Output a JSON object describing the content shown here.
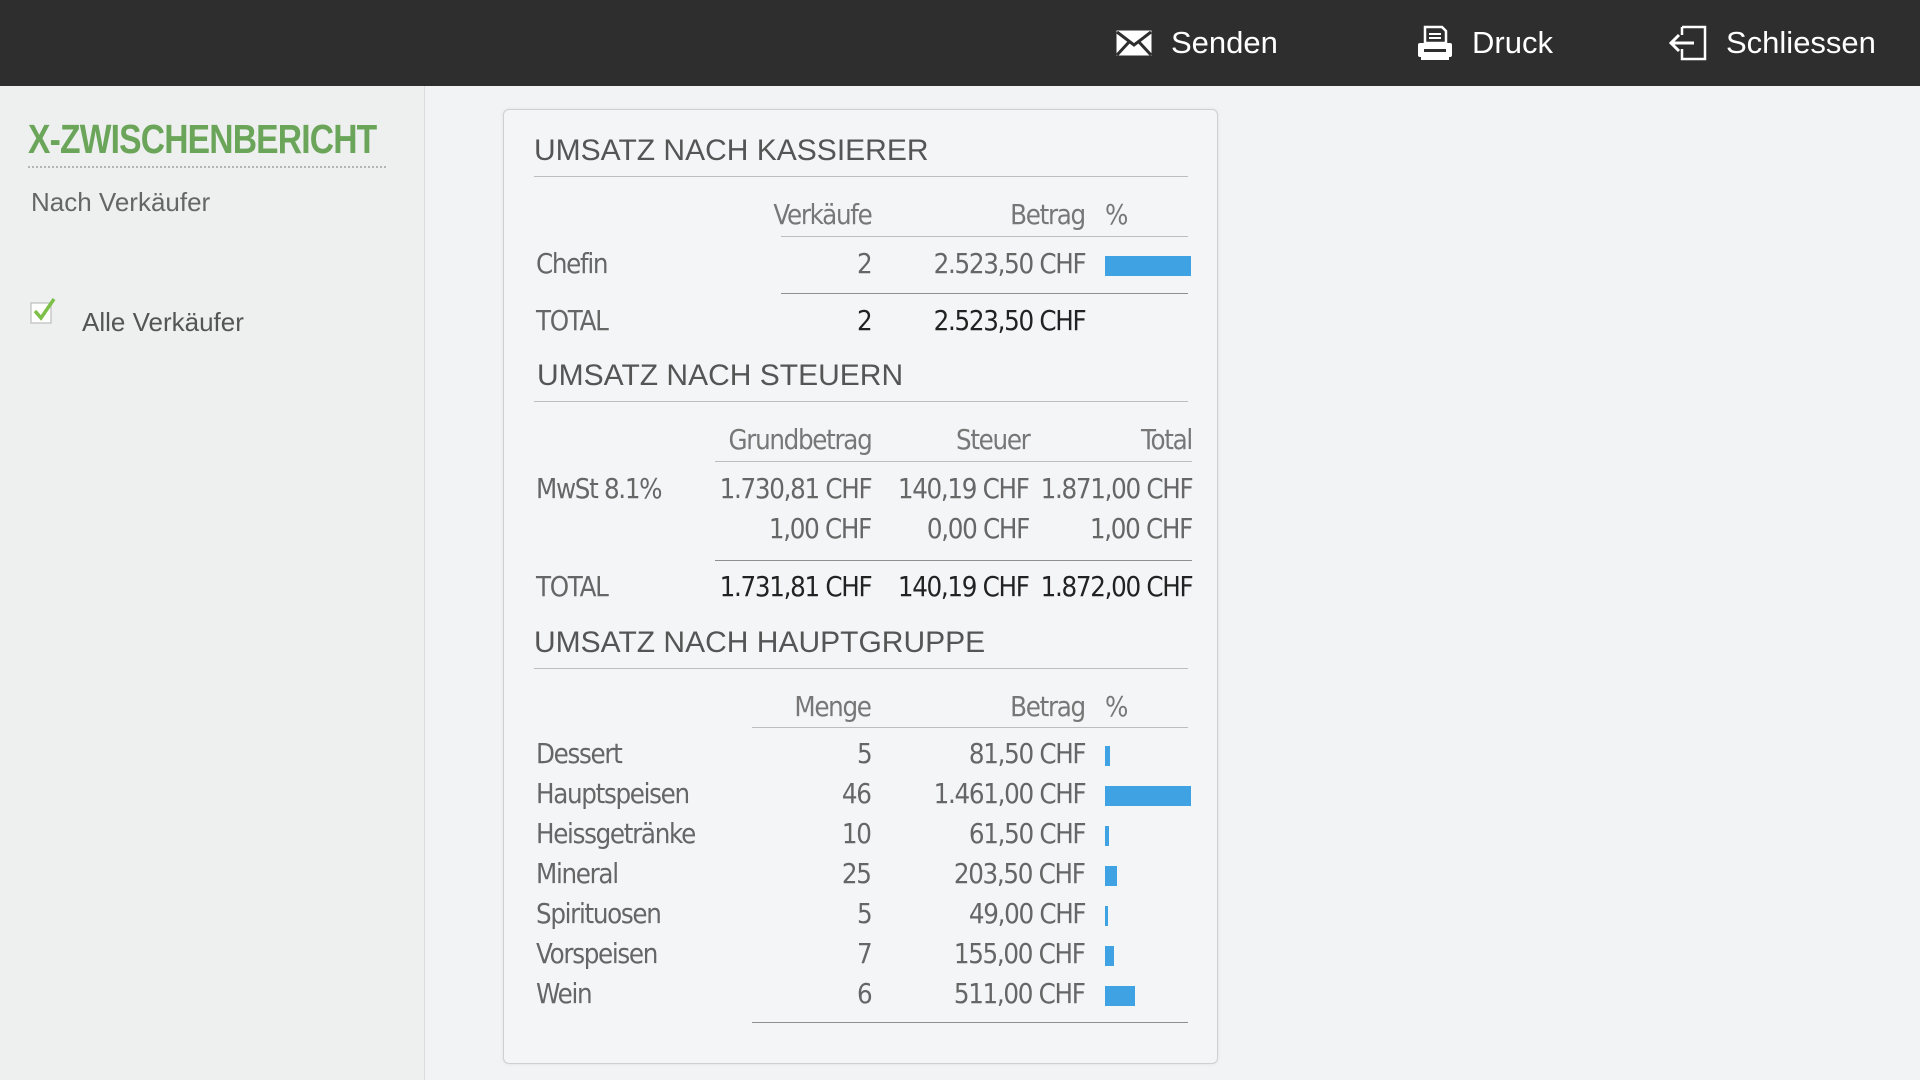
{
  "toolbar": {
    "send_label": "Senden",
    "print_label": "Druck",
    "close_label": "Schliessen",
    "send_icon": "envelope-icon",
    "print_icon": "printer-icon",
    "close_icon": "exit-icon"
  },
  "sidebar": {
    "title": "X-ZWISCHENBERICHT",
    "subtitle": "Nach Verkäufer",
    "filter": {
      "label": "Alle Verkäufer",
      "checked": true
    }
  },
  "colors": {
    "accent": "#6aa55a",
    "bar": "#3fa3e3",
    "topbar": "#2e2e2e"
  },
  "report": {
    "cashier": {
      "title": "UMSATZ NACH KASSIERER",
      "headers": {
        "count": "Verkäufe",
        "amount": "Betrag",
        "percent": "%"
      },
      "rows": [
        {
          "name": "Chefin",
          "count": "2",
          "amount": "2.523,50 CHF",
          "percent": 100
        }
      ],
      "total": {
        "label": "TOTAL",
        "count": "2",
        "amount": "2.523,50 CHF"
      }
    },
    "taxes": {
      "title": "UMSATZ NACH STEUERN",
      "headers": {
        "base": "Grundbetrag",
        "tax": "Steuer",
        "total": "Total"
      },
      "rows": [
        {
          "name": "MwSt 8.1%",
          "base": "1.730,81 CHF",
          "tax": "140,19 CHF",
          "total": "1.871,00 CHF"
        },
        {
          "name": "",
          "base": "1,00 CHF",
          "tax": "0,00 CHF",
          "total": "1,00 CHF"
        }
      ],
      "total": {
        "label": "TOTAL",
        "base": "1.731,81 CHF",
        "tax": "140,19 CHF",
        "total": "1.872,00 CHF"
      }
    },
    "groups": {
      "title": "UMSATZ NACH HAUPTGRUPPE",
      "headers": {
        "qty": "Menge",
        "amount": "Betrag",
        "percent": "%"
      },
      "rows": [
        {
          "name": "Dessert",
          "qty": "5",
          "amount": "81,50 CHF",
          "percent": 5.6
        },
        {
          "name": "Hauptspeisen",
          "qty": "46",
          "amount": "1.461,00 CHF",
          "percent": 100
        },
        {
          "name": "Heissgetränke",
          "qty": "10",
          "amount": "61,50 CHF",
          "percent": 4.2
        },
        {
          "name": "Mineral",
          "qty": "25",
          "amount": "203,50 CHF",
          "percent": 13.9
        },
        {
          "name": "Spirituosen",
          "qty": "5",
          "amount": "49,00 CHF",
          "percent": 3.4
        },
        {
          "name": "Vorspeisen",
          "qty": "7",
          "amount": "155,00 CHF",
          "percent": 10.6
        },
        {
          "name": "Wein",
          "qty": "6",
          "amount": "511,00 CHF",
          "percent": 35
        }
      ]
    }
  }
}
